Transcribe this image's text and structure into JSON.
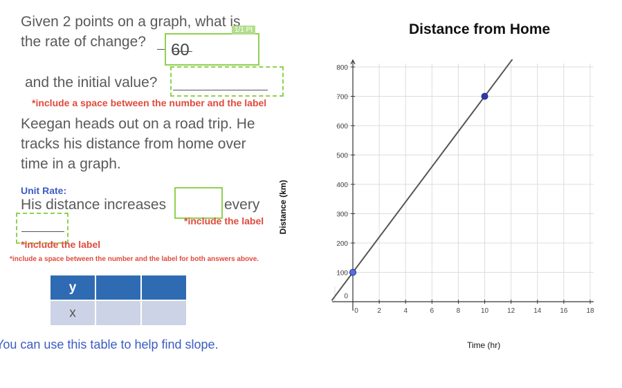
{
  "question1": {
    "line1": "Given 2 points on a graph, what is",
    "line2": "the rate of change?",
    "answer": "60",
    "points_badge": "1/1 Pt"
  },
  "question2": {
    "label": "and the initial value?",
    "note": "*include a space between the number and the label"
  },
  "scenario": {
    "line1": "Keegan heads out on a road trip. He",
    "line2": "tracks his distance from home over",
    "line3": "time in a graph."
  },
  "unit_rate": {
    "heading": "Unit Rate:",
    "sentence_start": "His distance increases",
    "sentence_mid": "every",
    "note_label_1": "*include the label",
    "note_label_2": "*include the label",
    "note_both": "*include a space between the number and the label for both answers above."
  },
  "table": {
    "row1_label": "y",
    "row2_label": "x"
  },
  "hint": "You can use this table to help find slope.",
  "chart_data": {
    "type": "line",
    "title": "Distance from Home",
    "xlabel": "Time (hr)",
    "ylabel": "Distance (km)",
    "xlim": [
      0,
      18
    ],
    "ylim": [
      0,
      800
    ],
    "xticks": [
      0,
      2,
      4,
      6,
      8,
      10,
      12,
      14,
      16,
      18
    ],
    "yticks": [
      0,
      100,
      200,
      300,
      400,
      500,
      600,
      700,
      800
    ],
    "grid": true,
    "series": [
      {
        "slope": 60,
        "intercept": 100,
        "x_range": [
          -1.6,
          12.1
        ],
        "color": "#555555"
      }
    ],
    "points": [
      {
        "x": 0,
        "y": 100
      },
      {
        "x": 10,
        "y": 700
      }
    ]
  }
}
